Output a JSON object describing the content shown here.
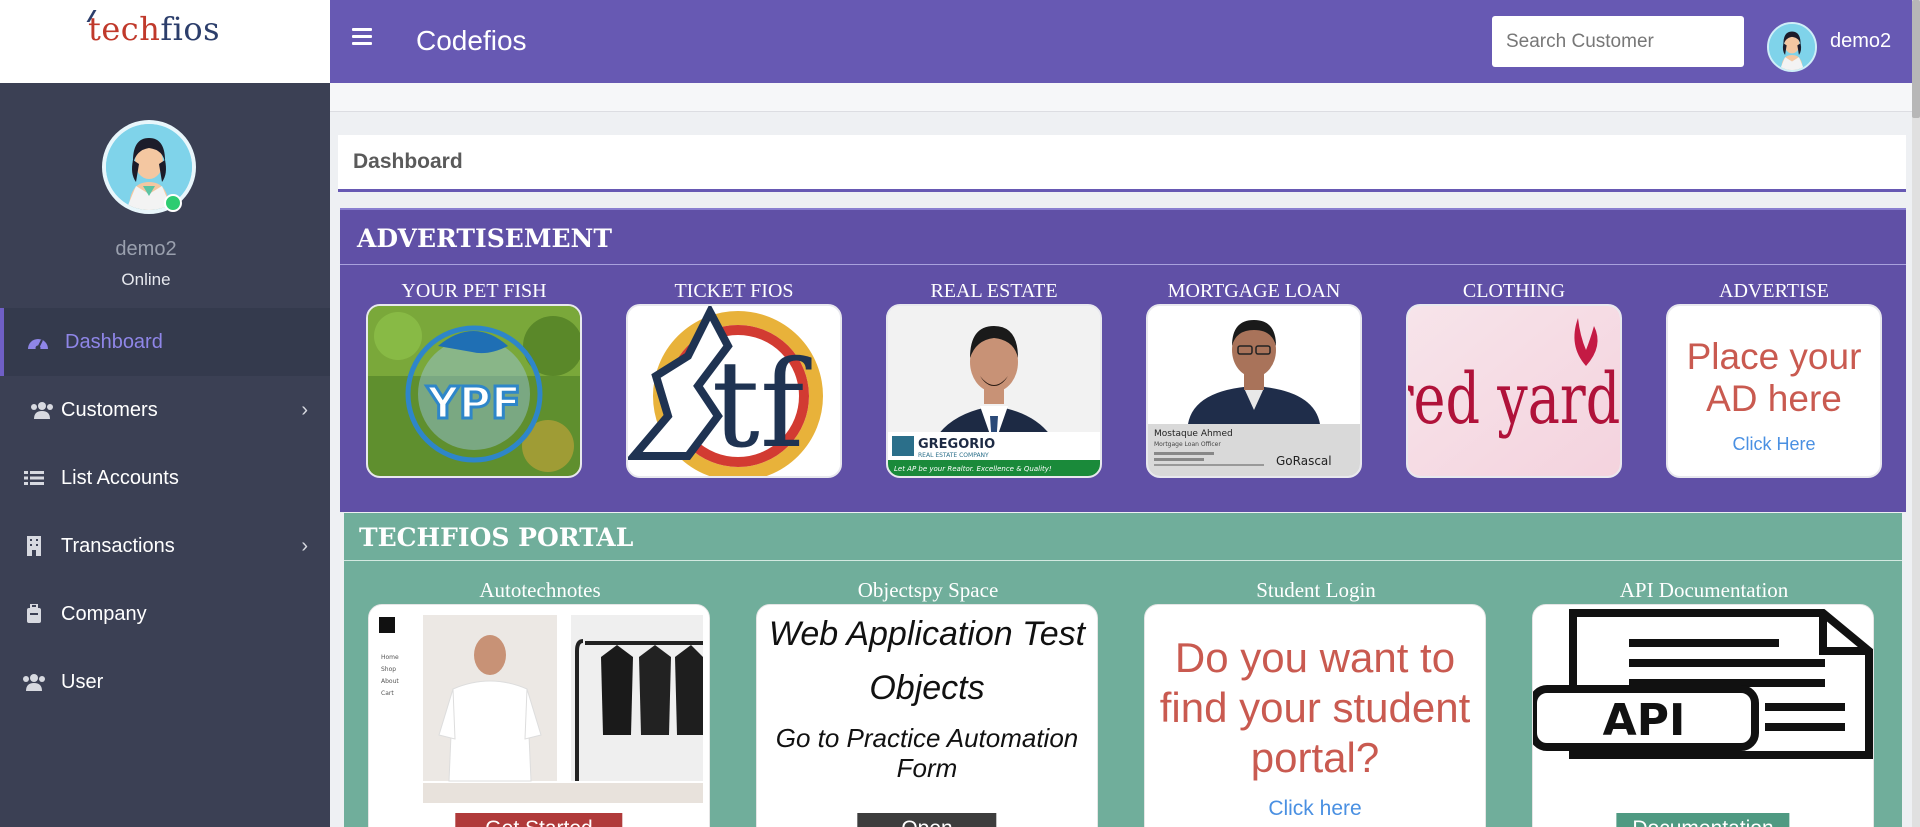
{
  "brand": {
    "logo_part1": "tech",
    "logo_part2": "fios"
  },
  "header": {
    "title": "Codefios",
    "search_placeholder": "Search Customer",
    "username": "demo2"
  },
  "sidebar": {
    "username": "demo2",
    "status": "Online",
    "items": [
      {
        "label": "Dashboard",
        "icon": "dashboard-icon"
      },
      {
        "label": "Customers",
        "icon": "users-icon"
      },
      {
        "label": "List Accounts",
        "icon": "list-icon"
      },
      {
        "label": "Transactions",
        "icon": "building-icon"
      },
      {
        "label": "Company",
        "icon": "briefcase-icon"
      },
      {
        "label": "User",
        "icon": "user-group-icon"
      }
    ]
  },
  "page": {
    "title": "Dashboard"
  },
  "advertisement": {
    "title": "ADVERTISEMENT",
    "items": [
      {
        "label": "YOUR PET FISH",
        "logo_text": "YPF"
      },
      {
        "label": "TICKET FIOS",
        "logo_text": "tf"
      },
      {
        "label": "REAL ESTATE",
        "brand": "GREGORIO",
        "sub": "REAL ESTATE COMPANY",
        "tagline": "Let AP be your Realtor. Excellence & Quality!"
      },
      {
        "label": "MORTGAGE LOAN",
        "name": "Mostaque Ahmed",
        "role": "Mortgage Loan Officer",
        "brand": "GoRascal"
      },
      {
        "label": "CLOTHING",
        "logo_text": "red yard"
      },
      {
        "label": "ADVERTISE",
        "headline": "Place your AD here",
        "link": "Click Here"
      }
    ]
  },
  "portal": {
    "title": "TECHFIOS PORTAL",
    "items": [
      {
        "label": "Autotechnotes",
        "button": "Get Started",
        "menu": [
          "Home",
          "Shop",
          "About",
          "Cart"
        ]
      },
      {
        "label": "Objectspy Space",
        "heading": "Web Application Test Objects",
        "text": "Go to Practice Automation Form",
        "button": "Open"
      },
      {
        "label": "Student Login",
        "heading": "Do you want to find your student portal?",
        "link": "Click here"
      },
      {
        "label": "API Documentation",
        "api_text": "API",
        "button": "Documentation"
      }
    ]
  },
  "colors": {
    "header": "#6759b3",
    "sidebar": "#3b4054",
    "ad_panel": "#6050a6",
    "portal_panel": "#70ae9b",
    "active_nav": "#8f86e8"
  }
}
